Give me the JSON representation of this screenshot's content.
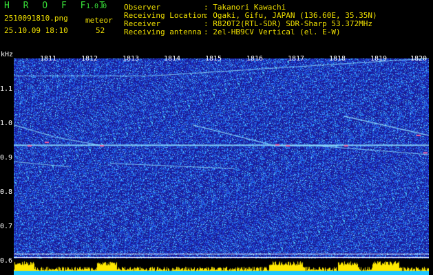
{
  "header": {
    "app_title": "H R O F F T",
    "version": "1.0.0",
    "filename": "2510091810.png",
    "meteor_label": "meteor",
    "datetime": "25.10.09 18:10",
    "meteor_count": "52",
    "info": [
      {
        "label": "Observer",
        "value": ": Takanori Kawachi"
      },
      {
        "label": "Receiving Location",
        "value": ": Ogaki, Gifu, JAPAN (136.60E, 35.35N)"
      },
      {
        "label": "Receiver",
        "value": ": R820T2(RTL-SDR) SDR-Sharp 53.372MHz"
      },
      {
        "label": "Receiving antenna",
        "value": ": 2el-HB9CV Vertical (el. E-W)"
      }
    ]
  },
  "axes": {
    "y_unit": "kHz",
    "time_ticks": [
      "1811",
      "1812",
      "1813",
      "1814",
      "1815",
      "1816",
      "1817",
      "1818",
      "1819",
      "1820"
    ],
    "freq_ticks": [
      "1.1",
      "1.0",
      "0.9",
      "0.8",
      "0.7",
      "0.6"
    ]
  },
  "colors": {
    "background": "#1a1aa0",
    "noise": "#3a8cff",
    "trace": "#8fe0ff",
    "signal_hot": "#ff60a0",
    "strip_yellow": "#ffe800",
    "strip_cyan": "#20c8ff",
    "text_yellow": "#f0e000",
    "text_green": "#38e038"
  }
}
